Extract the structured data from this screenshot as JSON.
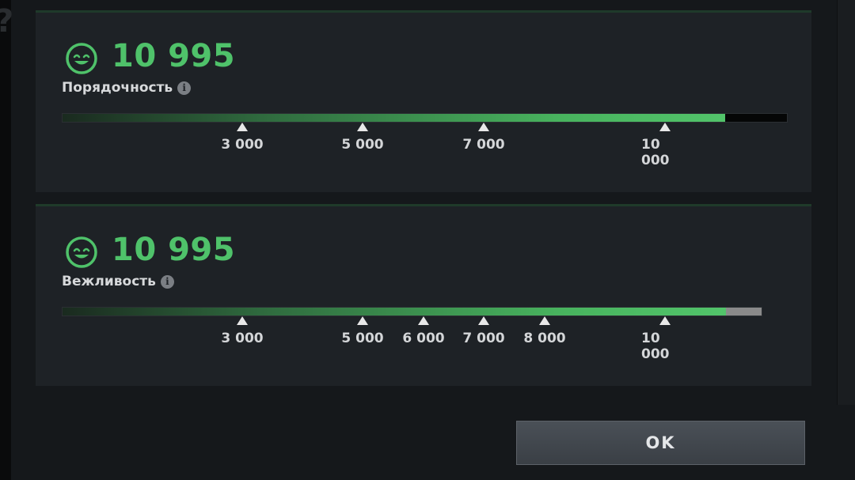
{
  "colors": {
    "accent_green": "#4fc26a",
    "track_bg_black": "#050606",
    "track_bg_grey": "#8a8a8a"
  },
  "panels": [
    {
      "icon": "smiley-face-icon",
      "score": "10 995",
      "label": "Порядочность",
      "fill_fraction": 0.915,
      "ticks": [
        "3 000",
        "5 000",
        "7 000",
        "10\n000"
      ]
    },
    {
      "icon": "smiley-face-icon",
      "score": "10 995",
      "label": "Вежливость",
      "fill_fraction": 0.949,
      "ticks": [
        "3 000",
        "5 000",
        "6 000",
        "7 000",
        "8 000",
        "10\n000"
      ]
    }
  ],
  "dialog": {
    "ok_label": "OK"
  }
}
